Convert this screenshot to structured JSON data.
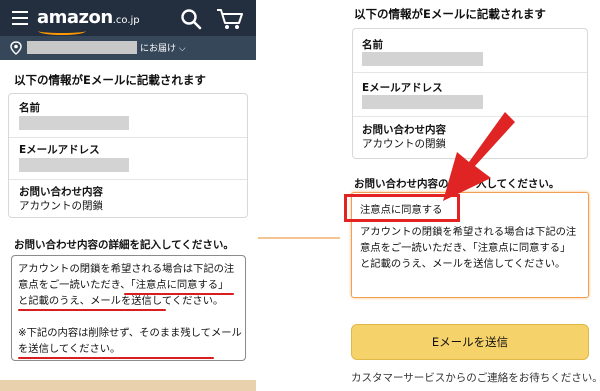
{
  "header": {
    "logo_text": "amazon",
    "logo_domain": ".co.jp",
    "deliver_to": "にお届け ⌵",
    "brand_color": "#232f3e",
    "accent_color": "#ff9900"
  },
  "form": {
    "section_title": "以下の情報がEメールに記載されます",
    "fields": [
      {
        "label": "名前"
      },
      {
        "label": "Eメールアドレス"
      },
      {
        "label": "お問い合わせ内容",
        "value": "アカウントの閉鎖"
      }
    ],
    "details_label": "お問い合わせ内容の詳細を記入してください。",
    "details_label_partial_left": "お問い合わせ内容の",
    "details_label_partial_right": "入してください。",
    "left_text_lines": [
      "アカウントの閉鎖を希望される場合は下記の注",
      "意点をご一読いただき、「注意点に同意する」",
      "と記載のうえ、メールを送信してください。",
      "",
      "※下記の内容は削除せず、そのまま残してメール",
      "を送信してください。"
    ],
    "right_first_line": "注意点に同意する",
    "right_text_lines": [
      "アカウントの閉鎖を希望される場合は下記の注",
      "意点をご一読いただき、「注意点に同意する」",
      "と記載のうえ、メールを送信してください。"
    ],
    "send_button": "Eメールを送信",
    "footer_text": "カスタマーサービスからのご連絡をお待ちください。",
    "highlight_color": "#e32222"
  }
}
